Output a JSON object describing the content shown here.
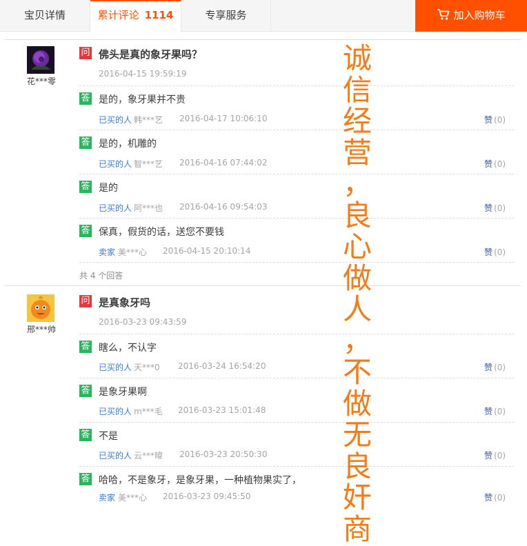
{
  "tabs": {
    "details": "宝贝详情",
    "reviews": "累计评论",
    "reviews_count": "1114",
    "services": "专享服务",
    "cart": "加入购物车"
  },
  "overlay_text": "诚信经营，良心做人，不做无良奸商",
  "threads": [
    {
      "user": "花***零",
      "question": "佛头是真的象牙果吗？",
      "date": "2016-04-15 19:59:19",
      "answers": [
        {
          "text": "是的，象牙果并不贵",
          "role": "已买的人",
          "who": "韩***艺",
          "date": "2016-04-17 10:06:10",
          "like": "赞",
          "likes": "(0)"
        },
        {
          "text": "是的，机雕的",
          "role": "已买的人",
          "who": "智***艺",
          "date": "2016-04-16 07:44:02",
          "like": "赞",
          "likes": "(0)"
        },
        {
          "text": "是的",
          "role": "已买的人",
          "who": "阿***也",
          "date": "2016-04-16 09:54:03",
          "like": "赞",
          "likes": "(0)"
        },
        {
          "text": "保真，假货的话，送您不要钱",
          "role": "卖家",
          "who": "美***心",
          "date": "2016-04-15 20:10:14",
          "like": "赞",
          "likes": "(0)"
        }
      ],
      "total": "共 4 个回答"
    },
    {
      "user": "邢***帅",
      "question": "是真象牙吗",
      "date": "2016-03-23 09:43:59",
      "answers": [
        {
          "text": "瞎么，不认字",
          "role": "已买的人",
          "who": "天***0",
          "date": "2016-03-24 16:54:20",
          "like": "赞",
          "likes": "(0)"
        },
        {
          "text": "是象牙果啊",
          "role": "已买的人",
          "who": "m***毛",
          "date": "2016-03-23 15:01:48",
          "like": "赞",
          "likes": "(0)"
        },
        {
          "text": "不是",
          "role": "已买的人",
          "who": "云***暐",
          "date": "2016-03-23 20:50:30",
          "like": "赞",
          "likes": "(0)"
        },
        {
          "text": "哈哈，不是象牙，是象牙果，一种植物果实了，",
          "role": "卖家",
          "who": "美***心",
          "date": "2016-03-23 09:45:50",
          "like": "赞",
          "likes": "(0)"
        }
      ]
    }
  ],
  "badges": {
    "question": "问",
    "answer": "答"
  },
  "colors": {
    "accent": "#ff5000",
    "question_badge": "#e4393c",
    "answer_badge": "#2db55d",
    "overlay": "#f07d18"
  }
}
